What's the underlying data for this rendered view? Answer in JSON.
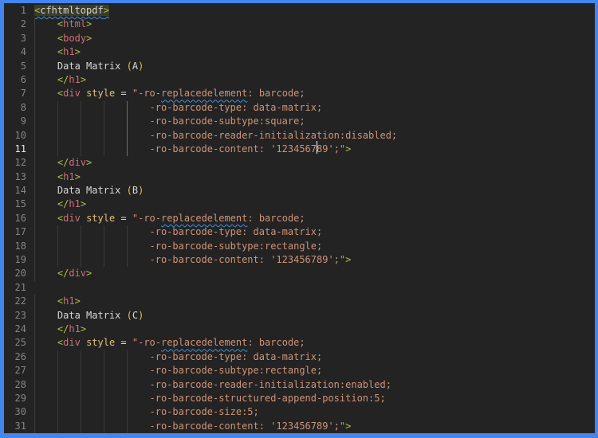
{
  "editor": {
    "active_line": 11,
    "colors": {
      "bg": "#232323",
      "border": "#4386f0",
      "lnum": "#858585",
      "lnum_active": "#e6e6e6",
      "guide": "#3b3b3b",
      "guide_active": "#6e6e6e",
      "punct": "#b5bd4b",
      "tag": "#d16d76",
      "attr": "#dec076",
      "plain": "#d6d6d6",
      "string": "#cf9379",
      "paren": "#e0c340",
      "squiggle": "#3d8fdb",
      "hl": "#3a3c28",
      "caret": "#ffffff"
    },
    "lines": [
      {
        "num": 1,
        "guides": [],
        "highlight": true,
        "tokens": [
          {
            "c": "p",
            "t": "<"
          },
          {
            "c": "w",
            "t": "cfhtmltopdf"
          },
          {
            "c": "p",
            "t": ">"
          }
        ]
      },
      {
        "num": 2,
        "guides": [
          0
        ],
        "tokens": [
          {
            "c": "w",
            "t": "    "
          },
          {
            "c": "p",
            "t": "<"
          },
          {
            "c": "t",
            "t": "html"
          },
          {
            "c": "p",
            "t": ">"
          }
        ]
      },
      {
        "num": 3,
        "guides": [
          0
        ],
        "tokens": [
          {
            "c": "w",
            "t": "    "
          },
          {
            "c": "p",
            "t": "<"
          },
          {
            "c": "t",
            "t": "body"
          },
          {
            "c": "p",
            "t": ">"
          }
        ]
      },
      {
        "num": 4,
        "guides": [
          0
        ],
        "tokens": [
          {
            "c": "w",
            "t": "    "
          },
          {
            "c": "p",
            "t": "<"
          },
          {
            "c": "t",
            "t": "h1"
          },
          {
            "c": "p",
            "t": ">"
          }
        ]
      },
      {
        "num": 5,
        "guides": [
          0
        ],
        "tokens": [
          {
            "c": "w",
            "t": "    Data Matrix "
          },
          {
            "c": "y",
            "t": "("
          },
          {
            "c": "w",
            "t": "A"
          },
          {
            "c": "y",
            "t": ")"
          }
        ]
      },
      {
        "num": 6,
        "guides": [
          0
        ],
        "tokens": [
          {
            "c": "w",
            "t": "    "
          },
          {
            "c": "p",
            "t": "</"
          },
          {
            "c": "t",
            "t": "h1"
          },
          {
            "c": "p",
            "t": ">"
          }
        ]
      },
      {
        "num": 7,
        "guides": [
          0
        ],
        "tokens": [
          {
            "c": "w",
            "t": "    "
          },
          {
            "c": "p",
            "t": "<"
          },
          {
            "c": "t",
            "t": "div"
          },
          {
            "c": "w",
            "t": " "
          },
          {
            "c": "a",
            "t": "style"
          },
          {
            "c": "w",
            "t": " = "
          },
          {
            "c": "s",
            "t": "\"-ro-"
          },
          {
            "c": "s",
            "t": "replacedelement",
            "sq": true
          },
          {
            "c": "s",
            "t": ": barcode;"
          }
        ]
      },
      {
        "num": 8,
        "guides": [
          0,
          4,
          8,
          12,
          16
        ],
        "active_guide": 16,
        "tokens": [
          {
            "c": "s",
            "t": "                    -ro-barcode-type: data-matrix;"
          }
        ]
      },
      {
        "num": 9,
        "guides": [
          0,
          4,
          8,
          12,
          16
        ],
        "active_guide": 16,
        "tokens": [
          {
            "c": "s",
            "t": "                    -ro-barcode-subtype:square;"
          }
        ]
      },
      {
        "num": 10,
        "guides": [
          0,
          4,
          8,
          12,
          16
        ],
        "active_guide": 16,
        "tokens": [
          {
            "c": "s",
            "t": "                    -ro-barcode-reader-initialization:disabled;"
          }
        ]
      },
      {
        "num": 11,
        "guides": [
          0,
          4,
          8,
          12,
          16
        ],
        "active_guide": 16,
        "tokens": [
          {
            "c": "s",
            "t": "                    -ro-barcode-content: '1234567"
          },
          {
            "caret": true
          },
          {
            "c": "s",
            "t": "89';\""
          },
          {
            "c": "p",
            "t": ">"
          }
        ]
      },
      {
        "num": 12,
        "guides": [
          0
        ],
        "tokens": [
          {
            "c": "w",
            "t": "    "
          },
          {
            "c": "p",
            "t": "</"
          },
          {
            "c": "t",
            "t": "div"
          },
          {
            "c": "p",
            "t": ">"
          }
        ]
      },
      {
        "num": 13,
        "guides": [
          0
        ],
        "tokens": [
          {
            "c": "w",
            "t": "    "
          },
          {
            "c": "p",
            "t": "<"
          },
          {
            "c": "t",
            "t": "h1"
          },
          {
            "c": "p",
            "t": ">"
          }
        ]
      },
      {
        "num": 14,
        "guides": [
          0
        ],
        "tokens": [
          {
            "c": "w",
            "t": "    Data Matrix "
          },
          {
            "c": "y",
            "t": "("
          },
          {
            "c": "w",
            "t": "B"
          },
          {
            "c": "y",
            "t": ")"
          }
        ]
      },
      {
        "num": 15,
        "guides": [
          0
        ],
        "tokens": [
          {
            "c": "w",
            "t": "    "
          },
          {
            "c": "p",
            "t": "</"
          },
          {
            "c": "t",
            "t": "h1"
          },
          {
            "c": "p",
            "t": ">"
          }
        ]
      },
      {
        "num": 16,
        "guides": [
          0
        ],
        "tokens": [
          {
            "c": "w",
            "t": "    "
          },
          {
            "c": "p",
            "t": "<"
          },
          {
            "c": "t",
            "t": "div"
          },
          {
            "c": "w",
            "t": " "
          },
          {
            "c": "a",
            "t": "style"
          },
          {
            "c": "w",
            "t": " = "
          },
          {
            "c": "s",
            "t": "\"-ro-"
          },
          {
            "c": "s",
            "t": "replacedelement",
            "sq": true
          },
          {
            "c": "s",
            "t": ": barcode;"
          }
        ]
      },
      {
        "num": 17,
        "guides": [
          0,
          4,
          8,
          12,
          16
        ],
        "tokens": [
          {
            "c": "s",
            "t": "                    -ro-barcode-type: data-matrix;"
          }
        ]
      },
      {
        "num": 18,
        "guides": [
          0,
          4,
          8,
          12,
          16
        ],
        "tokens": [
          {
            "c": "s",
            "t": "                    -ro-barcode-subtype:rectangle;"
          }
        ]
      },
      {
        "num": 19,
        "guides": [
          0,
          4,
          8,
          12,
          16
        ],
        "tokens": [
          {
            "c": "s",
            "t": "                    -ro-barcode-content: '123456789';\""
          },
          {
            "c": "p",
            "t": ">"
          }
        ]
      },
      {
        "num": 20,
        "guides": [
          0
        ],
        "tokens": [
          {
            "c": "w",
            "t": "    "
          },
          {
            "c": "p",
            "t": "</"
          },
          {
            "c": "t",
            "t": "div"
          },
          {
            "c": "p",
            "t": ">"
          }
        ]
      },
      {
        "num": 21,
        "guides": [],
        "tokens": []
      },
      {
        "num": 22,
        "guides": [
          0
        ],
        "tokens": [
          {
            "c": "w",
            "t": "    "
          },
          {
            "c": "p",
            "t": "<"
          },
          {
            "c": "t",
            "t": "h1"
          },
          {
            "c": "p",
            "t": ">"
          }
        ]
      },
      {
        "num": 23,
        "guides": [
          0
        ],
        "tokens": [
          {
            "c": "w",
            "t": "    Data Matrix "
          },
          {
            "c": "y",
            "t": "("
          },
          {
            "c": "w",
            "t": "C"
          },
          {
            "c": "y",
            "t": ")"
          }
        ]
      },
      {
        "num": 24,
        "guides": [
          0
        ],
        "tokens": [
          {
            "c": "w",
            "t": "    "
          },
          {
            "c": "p",
            "t": "</"
          },
          {
            "c": "t",
            "t": "h1"
          },
          {
            "c": "p",
            "t": ">"
          }
        ]
      },
      {
        "num": 25,
        "guides": [
          0
        ],
        "tokens": [
          {
            "c": "w",
            "t": "    "
          },
          {
            "c": "p",
            "t": "<"
          },
          {
            "c": "t",
            "t": "div"
          },
          {
            "c": "w",
            "t": " "
          },
          {
            "c": "a",
            "t": "style"
          },
          {
            "c": "w",
            "t": " = "
          },
          {
            "c": "s",
            "t": "\"-ro-"
          },
          {
            "c": "s",
            "t": "replacedelement",
            "sq": true
          },
          {
            "c": "s",
            "t": ": barcode;"
          }
        ]
      },
      {
        "num": 26,
        "guides": [
          0,
          4,
          8,
          12,
          16
        ],
        "tokens": [
          {
            "c": "s",
            "t": "                    -ro-barcode-type: data-matrix;"
          }
        ]
      },
      {
        "num": 27,
        "guides": [
          0,
          4,
          8,
          12,
          16
        ],
        "tokens": [
          {
            "c": "s",
            "t": "                    -ro-barcode-subtype:rectangle;"
          }
        ]
      },
      {
        "num": 28,
        "guides": [
          0,
          4,
          8,
          12,
          16
        ],
        "tokens": [
          {
            "c": "s",
            "t": "                    -ro-barcode-reader-initialization:enabled;"
          }
        ]
      },
      {
        "num": 29,
        "guides": [
          0,
          4,
          8,
          12,
          16
        ],
        "tokens": [
          {
            "c": "s",
            "t": "                    -ro-barcode-structured-append-position:5;"
          }
        ]
      },
      {
        "num": 30,
        "guides": [
          0,
          4,
          8,
          12,
          16
        ],
        "tokens": [
          {
            "c": "s",
            "t": "                    -ro-barcode-size:5;"
          }
        ]
      },
      {
        "num": 31,
        "guides": [
          0,
          4,
          8,
          12,
          16
        ],
        "tokens": [
          {
            "c": "s",
            "t": "                    -ro-barcode-content: '123456789';\""
          },
          {
            "c": "p",
            "t": ">"
          }
        ]
      }
    ]
  }
}
